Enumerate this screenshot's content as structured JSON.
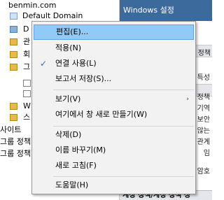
{
  "tree": {
    "domain": "benmin.com",
    "gpo_selected": "Default Domain",
    "fragments": [
      "D",
      "관",
      "회",
      "그",
      "W",
      "스"
    ],
    "sites": "사이트",
    "gp_modeling": "그룹 정책",
    "gp_results": "그룹 정책"
  },
  "right_pane": {
    "title": "Windows 설정",
    "fragments": [
      "정책",
      "특성",
      "기역",
      "보안",
      "않는",
      "관계",
      "임",
      "암호"
    ],
    "footer": "계정 정책/계정 정책 정"
  },
  "menu": {
    "items": [
      {
        "label": "편집(E)...",
        "highlighted": true
      },
      {
        "label": "적용(N)"
      },
      {
        "label": "연결 사용(L)",
        "checked": true
      },
      {
        "label": "보고서 저장(S)..."
      },
      {
        "label": "보기(V)",
        "submenu": true
      },
      {
        "label": "여기에서 창 새로 만들기(W)"
      },
      {
        "label": "삭제(D)"
      },
      {
        "label": "이름 바꾸기(M)"
      },
      {
        "label": "새로 고침(F)"
      },
      {
        "label": "도움말(H)"
      }
    ],
    "check_glyph": "✓",
    "submenu_glyph": "›"
  },
  "colors": {
    "highlight": "#91c9f7",
    "highlight_border": "#62a2e4",
    "check": "#2d6fc0"
  }
}
